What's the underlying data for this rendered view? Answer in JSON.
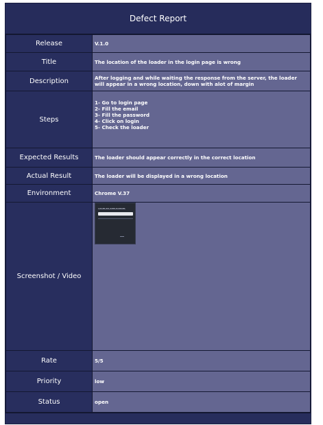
{
  "title": "Defect Report",
  "rows": {
    "release": {
      "label": "Release",
      "value": "V.1.0"
    },
    "title": {
      "label": "Title",
      "value": "The location of the loader in the login page is wrong"
    },
    "description": {
      "label": "Description",
      "value": "After logging and while waiting the response from the server, the loader will appear in a wrong location, down with alot of margin"
    },
    "steps": {
      "label": "Steps",
      "items": [
        "1- Go to login page",
        "2- Fill the email",
        "3- Fill the password",
        "4- Click on login",
        "5- Check the loader"
      ]
    },
    "expected": {
      "label": "Expected Results",
      "value": "The loader should appear correctly in the correct location"
    },
    "actual": {
      "label": "Actual Result",
      "value": "The loader will be displayed in a wrong location"
    },
    "environment": {
      "label": "Environment",
      "value": "Chrome V.37"
    },
    "screenshot": {
      "label": "Screenshot / Video",
      "thumb_title": "LOGIN TO APPLICATION"
    },
    "rate": {
      "label": "Rate",
      "value": "5/5"
    },
    "priority": {
      "label": "Priority",
      "value": "low"
    },
    "status": {
      "label": "Status",
      "value": "open"
    }
  }
}
